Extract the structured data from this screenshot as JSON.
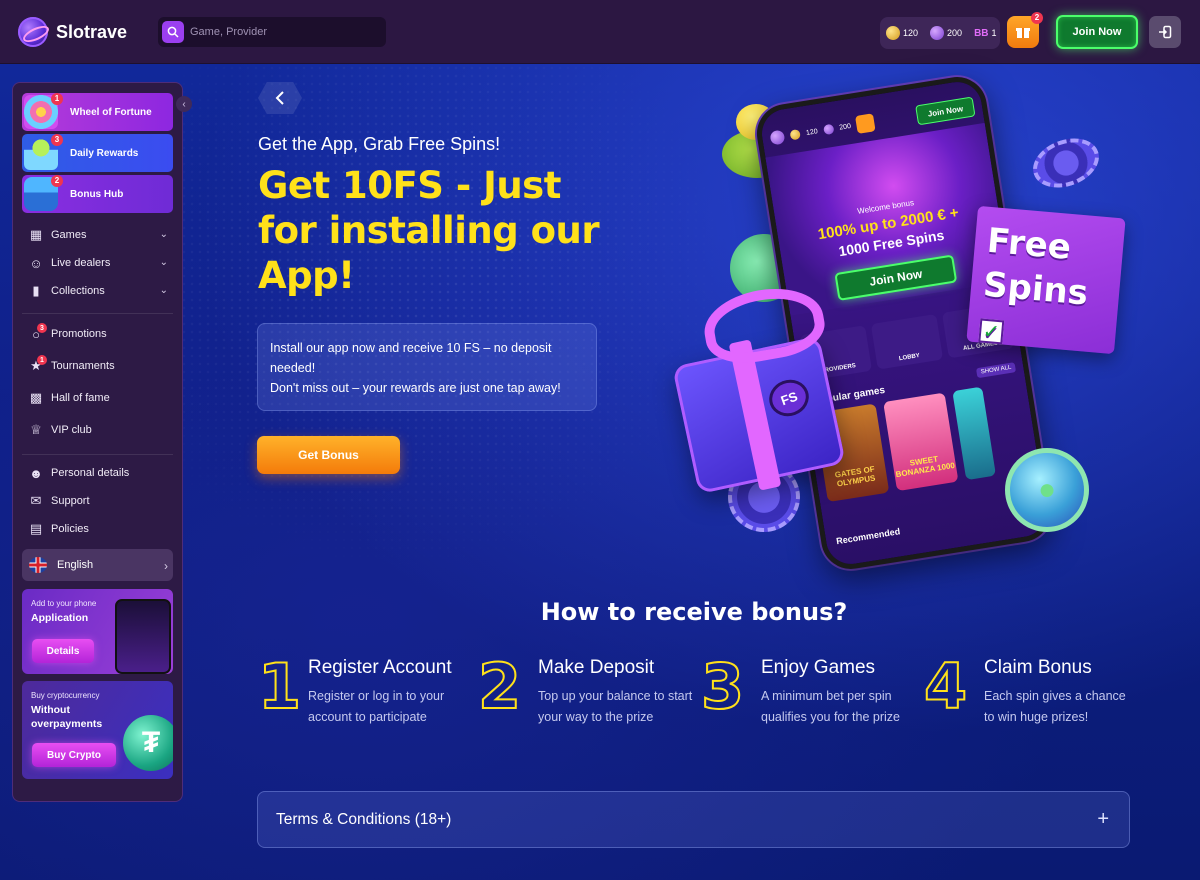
{
  "header": {
    "brand": "Slotrave",
    "search_placeholder": "Game, Provider",
    "wallet": {
      "coins": "120",
      "spins": "200",
      "bb_label": "BB",
      "bb_value": "1"
    },
    "gift_badge": "2",
    "join_label": "Join Now"
  },
  "sidebar": {
    "promos": [
      {
        "label": "Wheel of Fortune",
        "badge": "1"
      },
      {
        "label": "Daily Rewards",
        "badge": "3"
      },
      {
        "label": "Bonus Hub",
        "badge": "2"
      }
    ],
    "menu": {
      "games": "Games",
      "live_dealers": "Live dealers",
      "collections": "Collections",
      "promotions": "Promotions",
      "promotions_badge": "3",
      "tournaments": "Tournaments",
      "tournaments_badge": "1",
      "hall_of_fame": "Hall of fame",
      "vip_club": "VIP club",
      "personal_details": "Personal details",
      "support": "Support",
      "policies": "Policies"
    },
    "language": "English",
    "app_card": {
      "small": "Add to your phone",
      "big": "Application",
      "button": "Details"
    },
    "crypto_card": {
      "small": "Buy cryptocurrency",
      "big_line1": "Without",
      "big_line2": "overpayments",
      "button": "Buy Crypto"
    }
  },
  "hero": {
    "subtitle": "Get the App, Grab Free Spins!",
    "title": "Get 10FS - Just for installing our App!",
    "info_line1": "Install our app now and receive 10 FS – no deposit needed!",
    "info_line2": "Don't miss out – your rewards are just one tap away!",
    "button": "Get Bonus"
  },
  "art": {
    "phone_coins": "120",
    "phone_spins": "200",
    "phone_join": "Join Now",
    "welcome": "Welcome bonus",
    "offer_line1": "100% up to 2000 € +",
    "offer_line2": "1000 Free Spins",
    "offer_join": "Join Now",
    "cats": [
      "PROVIDERS",
      "LOBBY",
      "ALL GAMES"
    ],
    "popular": "Popular games",
    "show_all": "SHOW ALL",
    "game1": "GATES OF OLYMPUS",
    "game2": "SWEET BONANZA 1000",
    "recommended": "Recommended",
    "free_line1": "Free",
    "free_line2": "Spins",
    "fs_tag": "FS"
  },
  "how": {
    "title": "How to receive bonus?",
    "steps": [
      {
        "num": "1",
        "title": "Register Account",
        "desc": "Register or log in to your account to participate"
      },
      {
        "num": "2",
        "title": "Make Deposit",
        "desc": "Top up your balance to start your way to the prize"
      },
      {
        "num": "3",
        "title": "Enjoy Games",
        "desc": "A minimum bet per spin qualifies you for the prize"
      },
      {
        "num": "4",
        "title": "Claim Bonus",
        "desc": "Each spin gives a chance to win huge prizes!"
      }
    ]
  },
  "terms": {
    "label": "Terms & Conditions (18+)"
  },
  "colors": {
    "accent_yellow": "#ffe11a",
    "join_green": "#4bff6b",
    "bonus_orange": "#f47b0a",
    "sidebar_bg": "#2d1a45"
  }
}
